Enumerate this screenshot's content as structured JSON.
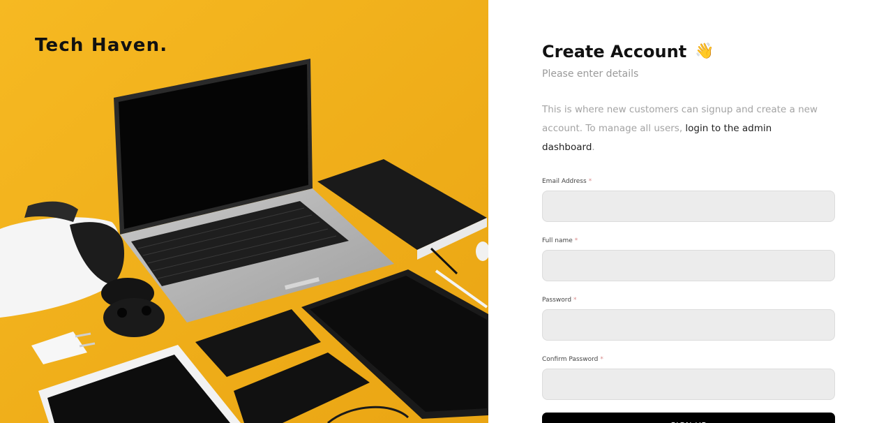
{
  "brand": {
    "name": "Tech Haven."
  },
  "form": {
    "title": "Create Account",
    "title_icon": "👋",
    "subtitle": "Please enter details",
    "intro_text": "This is where new customers can signup and create a new account. To manage all users, ",
    "intro_link": "login to the admin dashboard",
    "intro_end": ".",
    "required_mark": "*",
    "fields": [
      {
        "label": "Email Address",
        "value": "",
        "type": "email"
      },
      {
        "label": "Full name",
        "value": "",
        "type": "text"
      },
      {
        "label": "Password",
        "value": "",
        "type": "password"
      },
      {
        "label": "Confirm Password",
        "value": "",
        "type": "password"
      }
    ],
    "submit_label": "SIGN UP"
  },
  "colors": {
    "hero_background": "#f3b21b",
    "button": "#000000",
    "input_background": "#ececec"
  }
}
